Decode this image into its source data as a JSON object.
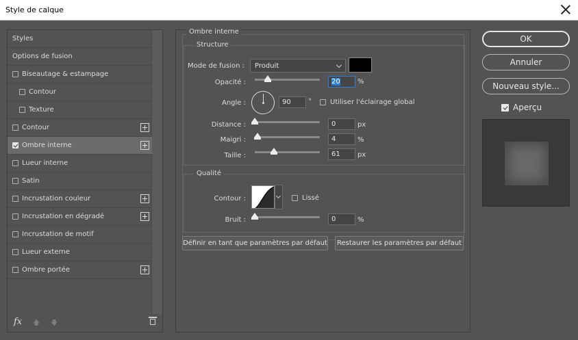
{
  "window": {
    "title": "Style de calque"
  },
  "styles_list": [
    {
      "label": "Styles",
      "type": "header"
    },
    {
      "label": "Options de fusion",
      "type": "header"
    },
    {
      "label": "Biseautage & estampage",
      "checked": false,
      "plus": false,
      "sub": false
    },
    {
      "label": "Contour",
      "checked": false,
      "plus": false,
      "sub": true
    },
    {
      "label": "Texture",
      "checked": false,
      "plus": false,
      "sub": true
    },
    {
      "label": "Contour",
      "checked": false,
      "plus": true,
      "sub": false
    },
    {
      "label": "Ombre interne",
      "checked": true,
      "plus": true,
      "sub": false,
      "selected": true
    },
    {
      "label": "Lueur interne",
      "checked": false,
      "plus": false,
      "sub": false
    },
    {
      "label": "Satin",
      "checked": false,
      "plus": false,
      "sub": false
    },
    {
      "label": "Incrustation couleur",
      "checked": false,
      "plus": true,
      "sub": false
    },
    {
      "label": "Incrustation en dégradé",
      "checked": false,
      "plus": true,
      "sub": false
    },
    {
      "label": "Incrustation de motif",
      "checked": false,
      "plus": false,
      "sub": false
    },
    {
      "label": "Lueur externe",
      "checked": false,
      "plus": false,
      "sub": false
    },
    {
      "label": "Ombre portée",
      "checked": false,
      "plus": true,
      "sub": false
    }
  ],
  "bottom_bar": {
    "fx_label": "fx"
  },
  "panel": {
    "title": "Ombre interne",
    "structure": {
      "legend": "Structure",
      "blend_label": "Mode de fusion :",
      "blend_value": "Produit",
      "color": "#000000",
      "opacity_label": "Opacité :",
      "opacity_value": "20",
      "opacity_unit": "%",
      "opacity_fraction": 0.2,
      "angle_label": "Angle :",
      "angle_value": "90",
      "angle_unit": "°",
      "global_light_label": "Utiliser l'éclairage global",
      "global_light_checked": false,
      "distance_label": "Distance :",
      "distance_value": "0",
      "distance_unit": "px",
      "choke_label": "Maigri :",
      "choke_value": "4",
      "choke_unit": "%",
      "size_label": "Taille :",
      "size_value": "61",
      "size_unit": "px"
    },
    "quality": {
      "legend": "Qualité",
      "contour_label": "Contour :",
      "antialias_label": "Lissé",
      "antialias_checked": false,
      "noise_label": "Bruit :",
      "noise_value": "0",
      "noise_unit": "%"
    },
    "buttons": {
      "make_default": "Définir en tant que paramètres par défaut",
      "reset_default": "Restaurer les paramètres par défaut"
    }
  },
  "right": {
    "ok": "OK",
    "cancel": "Annuler",
    "new_style": "Nouveau style...",
    "preview_label": "Aperçu",
    "preview_checked": true
  }
}
